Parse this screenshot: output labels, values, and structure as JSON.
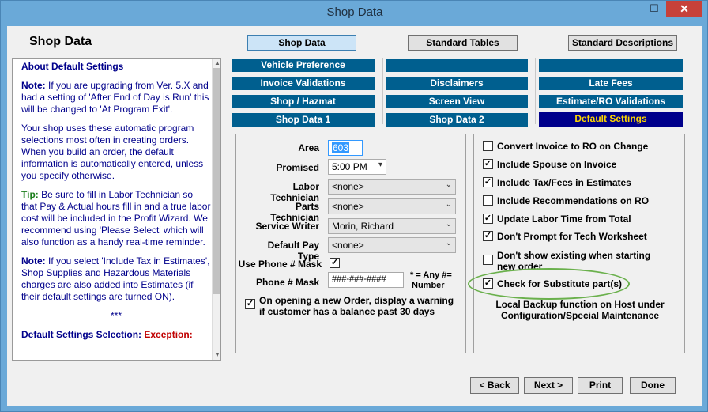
{
  "window": {
    "title": "Shop Data",
    "min_glyph": "—",
    "max_glyph": "☐",
    "close_glyph": "✕"
  },
  "app_title": "Shop Data",
  "top_tabs": [
    {
      "label": "Shop Data",
      "active": true
    },
    {
      "label": "Standard Tables",
      "active": false
    },
    {
      "label": "Standard Descriptions",
      "active": false
    }
  ],
  "help": {
    "heading": "About Default Settings",
    "note1_label": "Note:",
    "note1_text": " If you are upgrading from Ver. 5.X and had a setting of 'After End of Day is Run' this will be changed to 'At Program Exit'.",
    "para2": "Your shop uses these automatic program selections most often in creating orders. When you build an order, the default information is automatically entered, unless you specify otherwise.",
    "tip_label": "Tip:",
    "tip_text": " Be sure to fill in Labor Technician so that Pay & Actual hours fill in and a true labor cost will be included in the Profit Wizard. We recommend using 'Please Select' which will also function as a handy real-time reminder.",
    "note2_label": "Note:",
    "note2_text": " If you select 'Include Tax in Estimates', Shop Supplies and Hazardous Materials charges are also added into Estimates (if their default settings are turned ON).",
    "stars": "***",
    "cut_text_a": "Default Settings Selection:",
    "cut_text_b": "Exception:"
  },
  "nav": {
    "col1": [
      "Vehicle Preference",
      "Invoice Validations",
      "Shop / Hazmat",
      "Shop Data 1"
    ],
    "col2": [
      "",
      "Disclaimers",
      "Screen View",
      "Shop Data 2"
    ],
    "col3": [
      "",
      "Late Fees",
      "Estimate/RO Validations",
      "Default Settings"
    ],
    "selected": "Default Settings"
  },
  "left_form": {
    "area_label": "Area",
    "area_value": "603",
    "promised_label": "Promised",
    "promised_value": "5:00 PM",
    "labor_tech_label": "Labor Technician",
    "labor_tech_value": "<none>",
    "parts_tech_label": "Parts Technician",
    "parts_tech_value": "<none>",
    "service_writer_label": "Service Writer",
    "service_writer_value": "Morin, Richard",
    "pay_type_label": "Default Pay Type",
    "pay_type_value": "<none>",
    "phone_mask_use_label": "Use Phone # Mask",
    "phone_mask_use_checked": true,
    "phone_mask_label": "Phone # Mask",
    "phone_mask_value": "###-###-####",
    "phone_mask_hint_1": "* = Any #=",
    "phone_mask_hint_2": "Number",
    "balance_warning_label": "On opening a new Order, display a warning if customer has a balance past 30 days",
    "balance_warning_checked": true
  },
  "right_form": {
    "options": [
      {
        "label": "Convert Invoice to RO on Change",
        "checked": false
      },
      {
        "label": "Include Spouse on Invoice",
        "checked": true
      },
      {
        "label": "Include Tax/Fees in Estimates",
        "checked": true
      },
      {
        "label": "Include Recommendations on RO",
        "checked": false
      },
      {
        "label": "Update Labor Time from Total",
        "checked": true
      },
      {
        "label": "Don't Prompt for Tech Worksheet",
        "checked": true
      },
      {
        "label": "Don't show existing when starting new order",
        "checked": false
      },
      {
        "label": "Check for Substitute part(s)",
        "checked": true
      }
    ],
    "footer_note": "Local Backup function on Host under Configuration/Special Maintenance"
  },
  "bottom_buttons": {
    "back": "< Back",
    "next": "Next >",
    "print": "Print",
    "done": "Done"
  },
  "check_glyph": "✓",
  "colors": {
    "nav_button": "#005f8f",
    "nav_selected": "#00008b",
    "nav_selected_text": "#ffd700",
    "help_text": "#00008b",
    "tip_label": "#1a7d1a",
    "highlight_ring": "#6ab04c",
    "close_button": "#c7413a"
  }
}
